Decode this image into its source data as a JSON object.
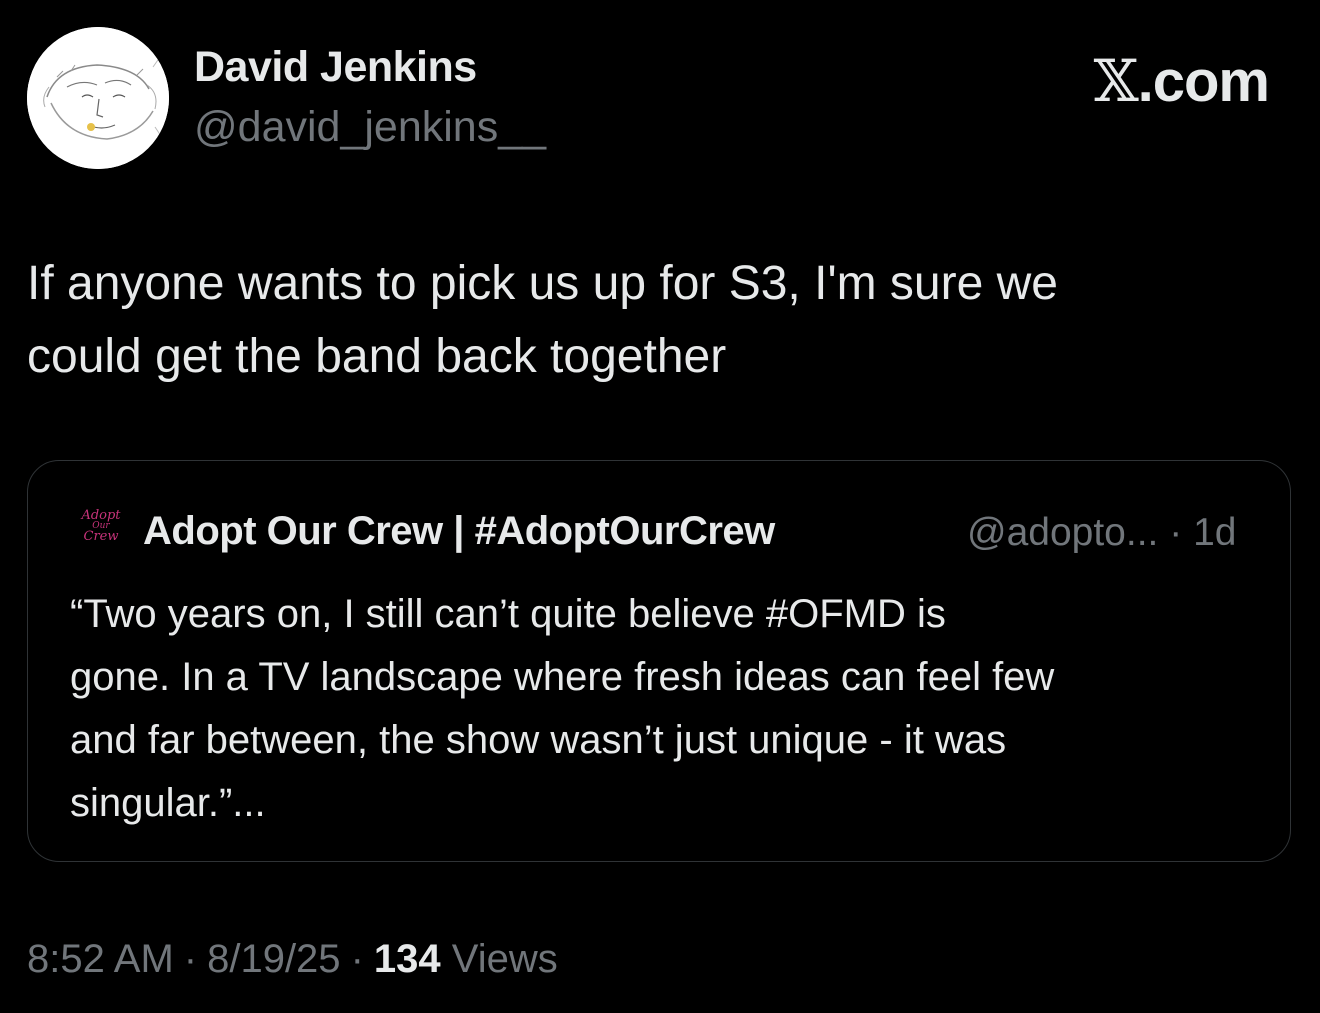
{
  "tweet": {
    "author": {
      "name": "David Jenkins",
      "handle": "@david_jenkins__"
    },
    "brand": {
      "x_glyph": "𝕏",
      "suffix": ".com"
    },
    "text_line1": "If anyone wants to pick us up for S3, I'm sure we",
    "text_line2": "could get the band back together",
    "quoted": {
      "logo_line1": "Adopt",
      "logo_line2": "Our",
      "logo_line3": "Crew",
      "name": "Adopt Our Crew | #AdoptOurCrew",
      "handle": "@adopto...",
      "separator": "·",
      "age": "1d",
      "text_line1": "“Two years on, I still can’t quite believe #OFMD is",
      "text_line2": "gone. In a TV landscape where fresh ideas can feel few",
      "text_line3": "and far between, the show wasn’t just unique - it was",
      "text_line4": "singular.”..."
    },
    "footer": {
      "time": "8:52 AM",
      "date": "8/19/25",
      "separator": "·",
      "views_count": "134",
      "views_label": "Views"
    }
  },
  "colors": {
    "background": "#000000",
    "primary_text": "#e7e9ea",
    "secondary_text": "#71767b",
    "border": "#2f3336",
    "logo_accent": "#c7337a"
  },
  "icons": {
    "avatar": "sketch-portrait-avatar",
    "quote_logo": "adopt-our-crew-logo"
  }
}
